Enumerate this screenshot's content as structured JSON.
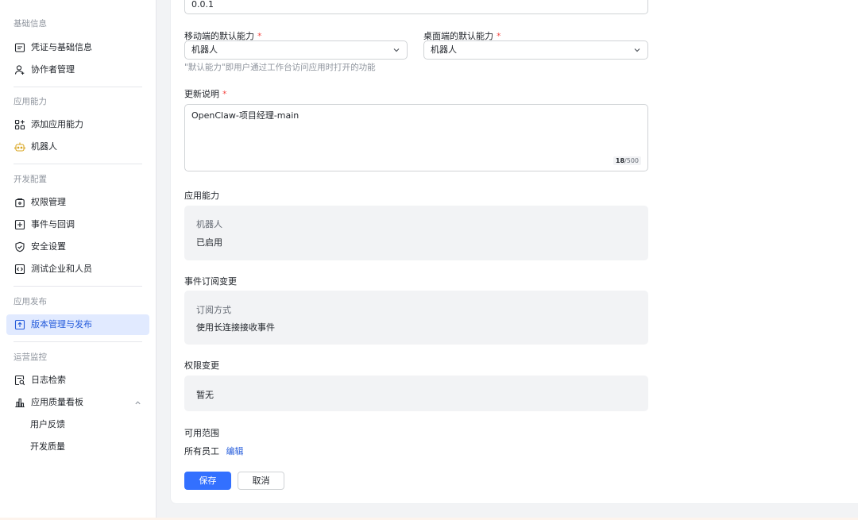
{
  "sidebar": {
    "sections": [
      {
        "title": "基础信息",
        "items": [
          {
            "label": "凭证与基础信息",
            "icon": "credential-icon"
          },
          {
            "label": "协作者管理",
            "icon": "user-icon"
          }
        ]
      },
      {
        "title": "应用能力",
        "items": [
          {
            "label": "添加应用能力",
            "icon": "apps-add-icon"
          },
          {
            "label": "机器人",
            "icon": "robot-icon"
          }
        ]
      },
      {
        "title": "开发配置",
        "items": [
          {
            "label": "权限管理",
            "icon": "lock-icon"
          },
          {
            "label": "事件与回调",
            "icon": "event-icon"
          },
          {
            "label": "安全设置",
            "icon": "shield-icon"
          },
          {
            "label": "测试企业和人员",
            "icon": "code-icon"
          }
        ]
      },
      {
        "title": "应用发布",
        "items": [
          {
            "label": "版本管理与发布",
            "icon": "upload-icon",
            "active": true
          }
        ]
      },
      {
        "title": "运营监控",
        "items": [
          {
            "label": "日志检索",
            "icon": "log-search-icon"
          },
          {
            "label": "应用质量看板",
            "icon": "bar-chart-icon",
            "expanded": true
          }
        ],
        "subitems": [
          {
            "label": "用户反馈"
          },
          {
            "label": "开发质量"
          }
        ]
      }
    ]
  },
  "form": {
    "version_value": "0.0.1",
    "mobile_default_label": "移动端的默认能力",
    "mobile_default_value": "机器人",
    "desktop_default_label": "桌面端的默认能力",
    "desktop_default_value": "机器人",
    "required_mark": "*",
    "default_hint": "\"默认能力\"即用户通过工作台访问应用时打开的功能",
    "release_notes_label": "更新说明",
    "release_notes_value": "OpenClaw-项目经理-main",
    "counter_current": "18",
    "counter_max": "/500",
    "capability_title": "应用能力",
    "capability_key": "机器人",
    "capability_value": "已启用",
    "event_title": "事件订阅变更",
    "event_key": "订阅方式",
    "event_value": "使用长连接接收事件",
    "permission_title": "权限变更",
    "permission_value": "暂无",
    "scope_title": "可用范围",
    "scope_value": "所有员工",
    "scope_edit": "编辑",
    "save_label": "保存",
    "cancel_label": "取消"
  },
  "colors": {
    "primary": "#3370ff",
    "active_bg": "#e1eaff",
    "active_text": "#245bdb",
    "required": "#f54a45",
    "panel_bg": "#f2f3f5"
  }
}
